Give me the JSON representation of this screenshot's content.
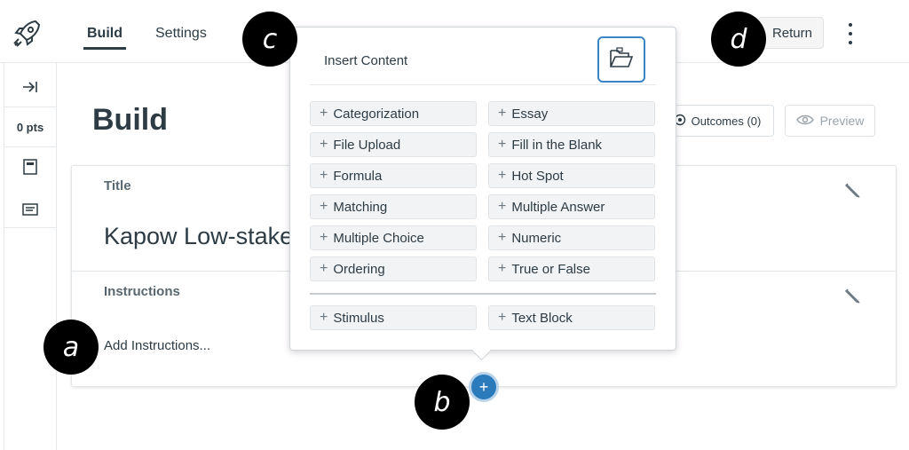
{
  "header": {
    "tabs": [
      {
        "label": "Build",
        "active": true
      },
      {
        "label": "Settings",
        "active": false
      }
    ],
    "return_label": "Return",
    "logo_icon": "rocket-icon",
    "menu_icon": "kebab-menu-icon"
  },
  "rail": {
    "expand_icon": "collapse-expand-icon",
    "points": "0 pts",
    "items": [
      {
        "icon": "assessment-page-icon"
      },
      {
        "icon": "instructions-text-icon"
      }
    ]
  },
  "main": {
    "page_title": "Build",
    "outcomes_label": "Outcomes (0)",
    "preview_label": "Preview",
    "title_label": "Title",
    "title_value": "Kapow Low-stake",
    "instructions_label": "Instructions",
    "instructions_placeholder": "Add Instructions..."
  },
  "popover": {
    "title": "Insert Content",
    "folder_icon": "open-folder-icon",
    "items_left": [
      "Categorization",
      "File Upload",
      "Formula",
      "Matching",
      "Multiple Choice",
      "Ordering"
    ],
    "items_right": [
      "Essay",
      "Fill in the Blank",
      "Hot Spot",
      "Multiple Answer",
      "Numeric",
      "True or False"
    ],
    "extras": [
      "Stimulus",
      "Text Block"
    ]
  },
  "callouts": {
    "a": "a",
    "b": "b",
    "c": "c",
    "d": "d"
  },
  "colors": {
    "accent": "#2b7abc",
    "text": "#2d3b45",
    "callout": "#000000"
  }
}
